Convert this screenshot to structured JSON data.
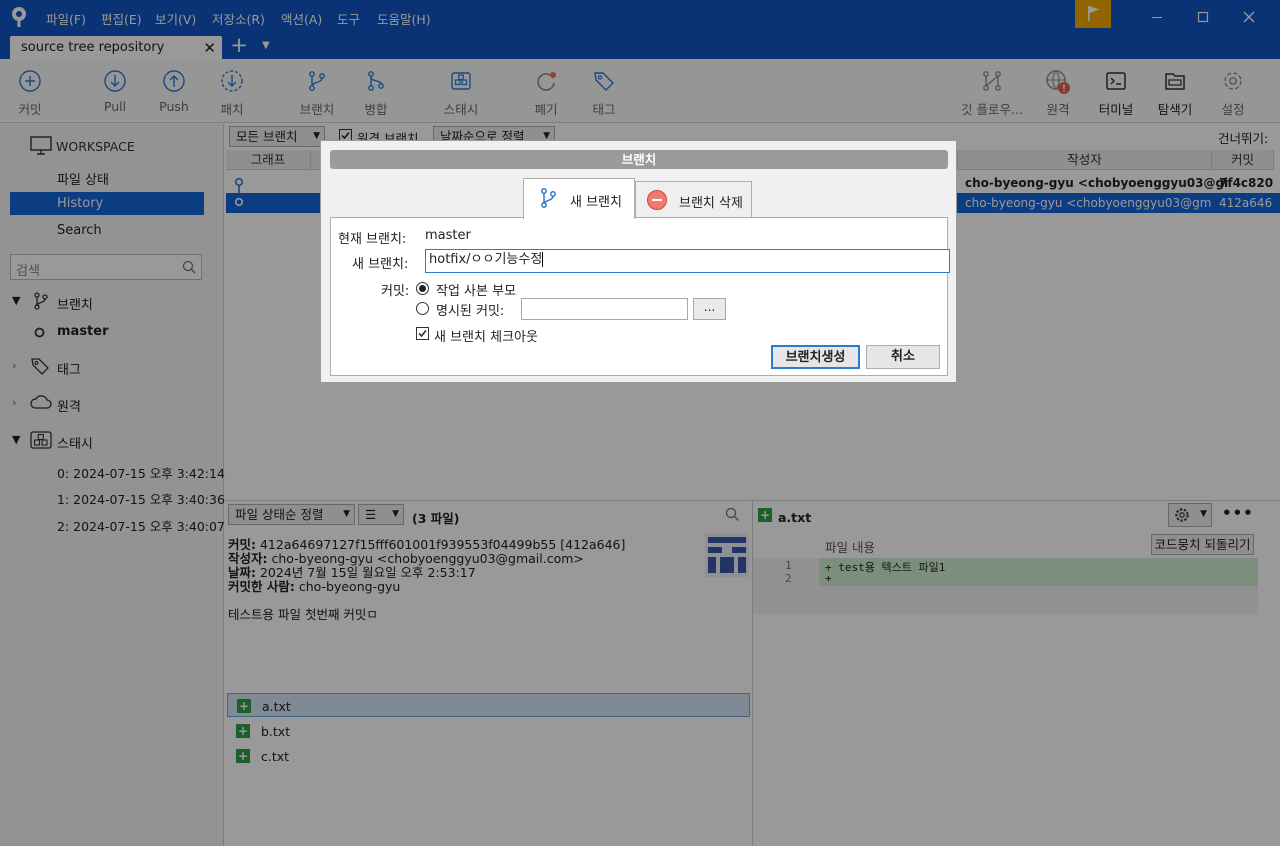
{
  "titlebar": {
    "menu": [
      "파일(F)",
      "편집(E)",
      "보기(V)",
      "저장소(R)",
      "액션(A)",
      "도구",
      "도움말(H)"
    ],
    "window_controls": [
      "minimize-icon",
      "maximize-icon",
      "close-icon"
    ]
  },
  "tabs": {
    "repo_tab_label": "source tree repository",
    "close_glyph": "✕",
    "add_glyph": "+",
    "menu_glyph": "▼"
  },
  "toolbar": {
    "commit": "커밋",
    "pull": "Pull",
    "push": "Push",
    "fetch": "패치",
    "branch": "브랜치",
    "merge": "병합",
    "stash": "스태시",
    "discard": "폐기",
    "tag": "태그",
    "git_flow": "깃 플로우...",
    "remote": "원격",
    "terminal": "터미널",
    "explorer": "탐색기",
    "settings": "설정"
  },
  "sidebar": {
    "workspace": "WORKSPACE",
    "items": [
      "파일 상태",
      "History",
      "Search"
    ],
    "search_placeholder": "검색",
    "sections": {
      "branches": "브랜치",
      "current_branch": "master",
      "tags": "태그",
      "remotes": "원격",
      "stashes": "스태시"
    },
    "stash_items": [
      "0: 2024-07-15 오후 3:42:14",
      "1: 2024-07-15 오후 3:40:36",
      "2: 2024-07-15 오후 3:40:07"
    ]
  },
  "history": {
    "branch_filter": "모든 브랜치",
    "remote_branch_check": "원격 브랜치",
    "sort": "날짜순으로 정렬",
    "jump_to": "건너뛰기:",
    "columns": {
      "graph": "그래프",
      "author": "작성자",
      "commit": "커밋"
    },
    "rows": [
      {
        "author": "cho-byeong-gyu <chobyoenggyu03@gi",
        "commit": "7f4c820"
      },
      {
        "author": "cho-byeong-gyu <chobyoenggyu03@gm",
        "commit": "412a646"
      }
    ]
  },
  "details": {
    "sort": "파일 상태순 정렬",
    "file_count": "(3 파일)",
    "commit_label": "커밋:",
    "commit_value": "412a64697127f15fff601001f939553f04499b55 [412a646]",
    "author_label": "작성자:",
    "author_value": "cho-byeong-gyu <chobyoenggyu03@gmail.com>",
    "date_label": "날짜:",
    "date_value": "2024년 7월 15일 월요일 오후 2:53:17",
    "committer_label": "커밋한 사람:",
    "committer_value": "cho-byeong-gyu",
    "message": "테스트용 파일 첫번째 커밋ㅁ",
    "files": [
      "a.txt",
      "b.txt",
      "c.txt"
    ]
  },
  "diff": {
    "file": "a.txt",
    "content_label": "파일 내용",
    "revert_button": "코드뭉치 되돌리기",
    "lines": [
      {
        "num": "1",
        "text": "+ test용 텍스트 파일1"
      },
      {
        "num": "2",
        "text": "+"
      }
    ]
  },
  "dialog": {
    "title": "브랜치",
    "tab_new": "새 브랜치",
    "tab_delete": "브랜치 삭제",
    "current_branch_label": "현재 브랜치:",
    "current_branch_value": "master",
    "new_branch_label": "새 브랜치:",
    "new_branch_value": "hotfix/ㅇㅇ기능수정",
    "commit_label": "커밋:",
    "option_parent": "작업 사본 부모",
    "option_specified": "명시된 커밋:",
    "browse": "...",
    "checkout": "새 브랜치 체크아웃",
    "create_button": "브랜치생성",
    "cancel_button": "취소"
  },
  "colors": {
    "titlebar": "#0f56c2",
    "selection": "#1565d8",
    "flag": "#f6a800",
    "added": "#2f9e44"
  }
}
